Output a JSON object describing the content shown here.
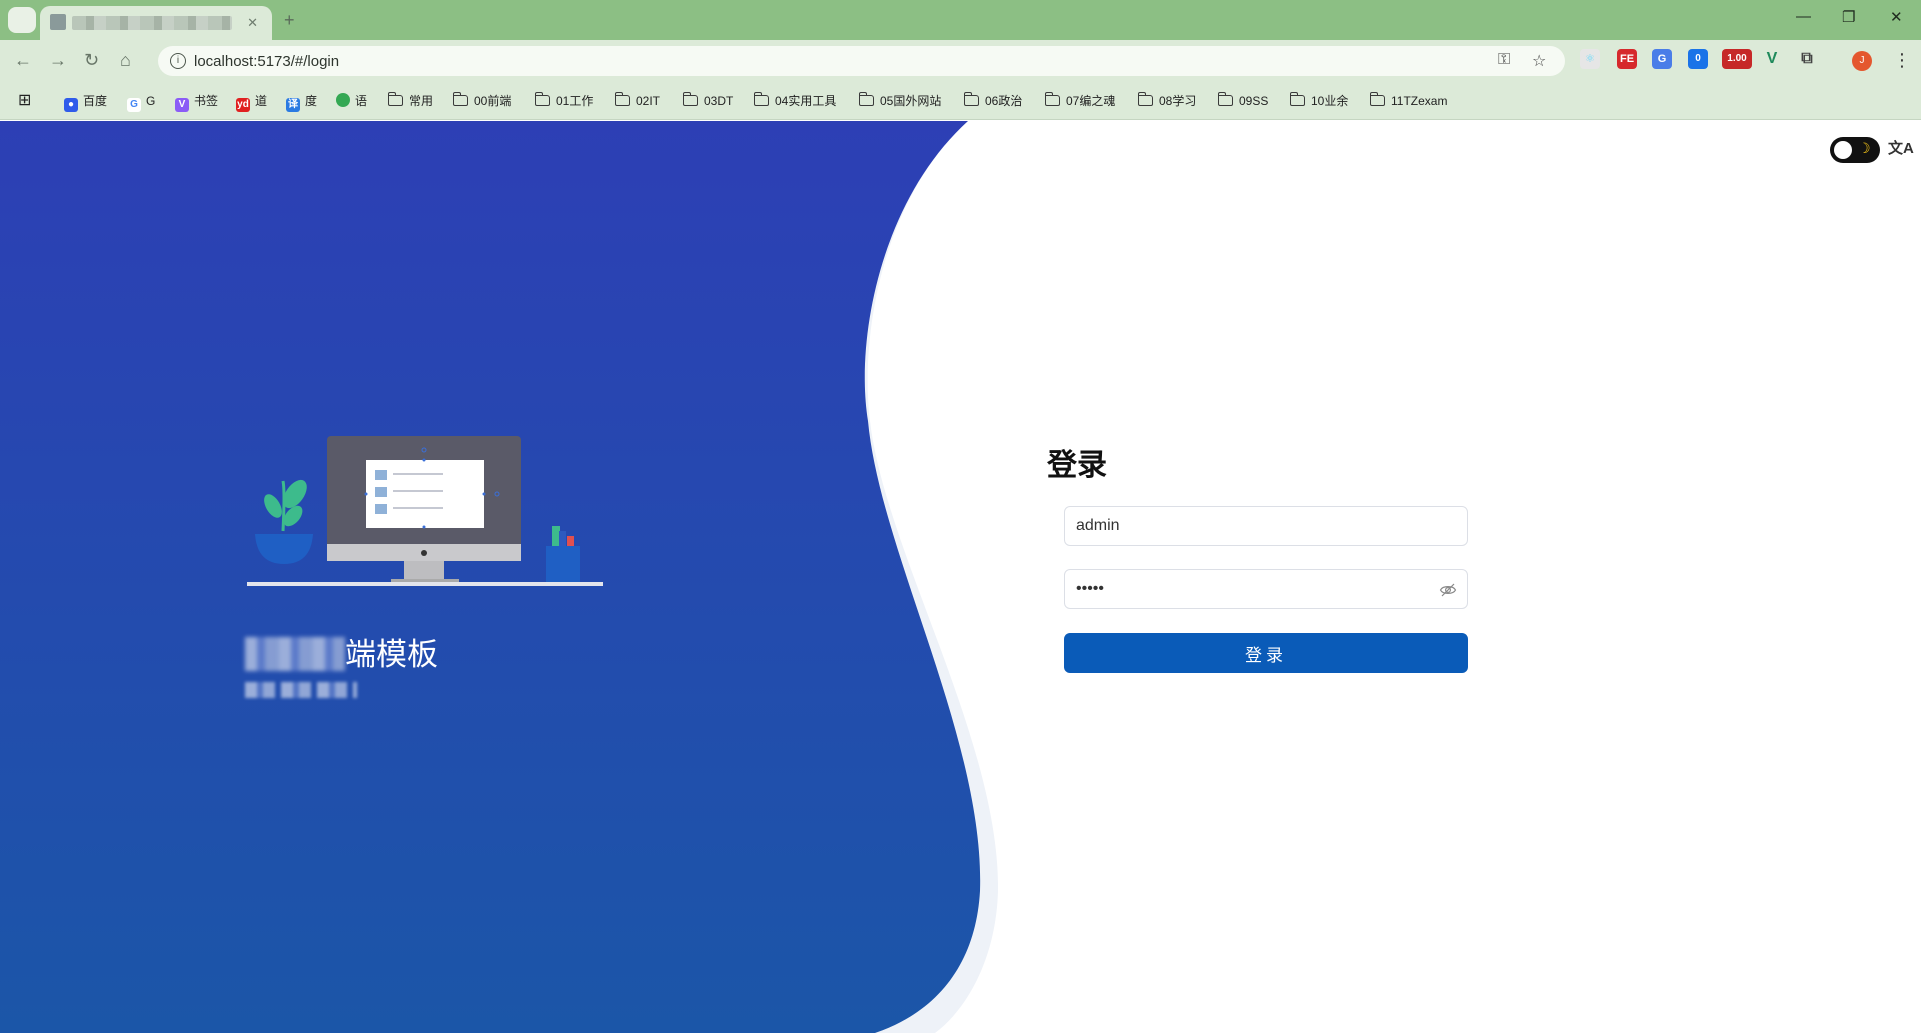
{
  "browser": {
    "tab": {
      "title_redacted": true
    },
    "address": {
      "url": "localhost:5173/#/login"
    },
    "extensions": [
      {
        "name": "react-devtools-icon",
        "label": ""
      },
      {
        "name": "fe-extension-icon",
        "label": "FE"
      },
      {
        "name": "translate-extension-icon",
        "label": ""
      },
      {
        "name": "badge-extension-icon",
        "label": "0"
      },
      {
        "name": "rate-extension-icon",
        "label": "1.00"
      },
      {
        "name": "vue-devtools-icon",
        "label": "V"
      },
      {
        "name": "puzzle-extensions-icon",
        "label": ""
      }
    ],
    "profile_initial": "J",
    "bookmarks": [
      {
        "type": "site",
        "icon": "baidu-icon",
        "label": "百度",
        "color": "#2f5bea"
      },
      {
        "type": "site",
        "icon": "google-icon",
        "label": "G",
        "color": "#4285f4"
      },
      {
        "type": "site",
        "icon": "vite-icon",
        "label": "书签",
        "color": "#8b5cf6"
      },
      {
        "type": "site",
        "icon": "youdao-icon",
        "label": "道",
        "color": "#e02020"
      },
      {
        "type": "site",
        "icon": "translate-icon",
        "label": "度",
        "color": "#2a7ae2"
      },
      {
        "type": "site",
        "icon": "leaf-icon",
        "label": "语",
        "color": "#34a853"
      },
      {
        "type": "folder",
        "label": "常用"
      },
      {
        "type": "folder",
        "label": "00前端"
      },
      {
        "type": "folder",
        "label": "01工作"
      },
      {
        "type": "folder",
        "label": "02IT"
      },
      {
        "type": "folder",
        "label": "03DT"
      },
      {
        "type": "folder",
        "label": "04实用工具"
      },
      {
        "type": "folder",
        "label": "05国外网站"
      },
      {
        "type": "folder",
        "label": "06政治"
      },
      {
        "type": "folder",
        "label": "07编之魂"
      },
      {
        "type": "folder",
        "label": "08学习"
      },
      {
        "type": "folder",
        "label": "09SS"
      },
      {
        "type": "folder",
        "label": "10业余"
      },
      {
        "type": "folder",
        "label": "11TZexam"
      }
    ]
  },
  "brand": {
    "title_visible": "端模板"
  },
  "login": {
    "title": "登录",
    "username": "admin",
    "password": "•••••",
    "submit_label": "登录"
  },
  "colors": {
    "brand_blue_top": "#2d3fb5",
    "brand_blue_bottom": "#1b56a8",
    "button": "#0a5bb8",
    "browser_frame": "#8cbf84"
  }
}
